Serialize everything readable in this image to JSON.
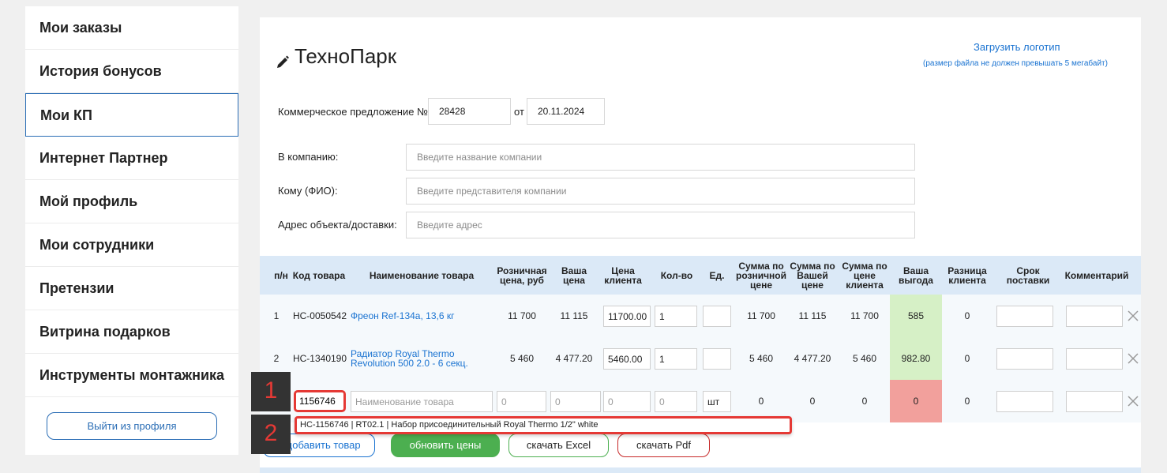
{
  "sidebar": {
    "items": [
      {
        "label": "Мои заказы"
      },
      {
        "label": "История бонусов"
      },
      {
        "label": "Мои КП"
      },
      {
        "label": "Интернет Партнер"
      },
      {
        "label": "Мой профиль"
      },
      {
        "label": "Мои сотрудники"
      },
      {
        "label": "Претензии"
      },
      {
        "label": "Витрина подарков"
      },
      {
        "label": "Инструменты монтажника"
      }
    ],
    "logout_label": "Выйти из профиля"
  },
  "header": {
    "title": "ТехноПарк",
    "upload_logo": "Загрузить логотип",
    "upload_note": "(размер файла не должен превышать 5 мегабайт)"
  },
  "offer": {
    "number_label": "Коммерческое предложение №",
    "number": "28428",
    "date_label": "от",
    "date": "20.11.2024"
  },
  "form": {
    "company_label": "В компанию:",
    "company_placeholder": "Введите название компании",
    "contact_label": "Кому (ФИО):",
    "contact_placeholder": "Введите представителя компании",
    "address_label": "Адрес объекта/доставки:",
    "address_placeholder": "Введите адрес"
  },
  "table": {
    "headers": {
      "num": "п/н",
      "code": "Код товара",
      "name": "Наименование товара",
      "retail_price": "Розничная цена, руб",
      "your_price": "Ваша цена",
      "client_price": "Цена клиента",
      "qty": "Кол-во",
      "unit": "Ед.",
      "sum_retail": "Сумма по розничной цене",
      "sum_yours": "Сумма по Вашей цене",
      "sum_client": "Сумма по цене клиента",
      "benefit": "Ваша выгода",
      "client_diff": "Разница клиента",
      "delivery": "Срок поставки",
      "comment": "Комментарий"
    },
    "rows": [
      {
        "num": "1",
        "code": "НС-0050542",
        "name": "Фреон Ref-134a, 13,6 кг",
        "retail_price": "11 700",
        "your_price": "11 115",
        "client_price": "11700.00",
        "qty": "1",
        "sum_retail": "11 700",
        "sum_yours": "11 115",
        "sum_client": "11 700",
        "benefit": "585",
        "client_diff": "0"
      },
      {
        "num": "2",
        "code": "НС-1340190",
        "name": "Радиатор Royal Thermo Revolution 500 2.0 - 6 секц.",
        "retail_price": "5 460",
        "your_price": "4 477.20",
        "client_price": "5460.00",
        "qty": "1",
        "sum_retail": "5 460",
        "sum_yours": "4 477.20",
        "sum_client": "5 460",
        "benefit": "982.80",
        "client_diff": "0"
      }
    ],
    "new_row": {
      "code": "1156746",
      "name_placeholder": "Наименование товара",
      "retail_placeholder": "0",
      "your_placeholder": "0",
      "client_placeholder": "0",
      "qty_placeholder": "0",
      "unit": "шт",
      "sum_retail": "0",
      "sum_yours": "0",
      "sum_client": "0",
      "benefit": "0",
      "client_diff": "0"
    },
    "suggestion": "НС-1156746 | RT02.1 | Набор присоединительный Royal Thermo 1/2\" white"
  },
  "buttons": {
    "add": "добавить товар",
    "add_prefix": "+",
    "refresh": "обновить цены",
    "excel": "скачать Excel",
    "pdf": "скачать Pdf"
  },
  "annotations": {
    "badge1": "1",
    "badge2": "2"
  },
  "colors": {
    "accent": "#1a73d1",
    "benefit_positive": "#d6f0c6",
    "benefit_zero": "#f2a09c",
    "refresh_btn": "#4caf50",
    "excel_border": "#4caf50",
    "pdf_border": "#c62828",
    "highlight": "#e53935"
  }
}
